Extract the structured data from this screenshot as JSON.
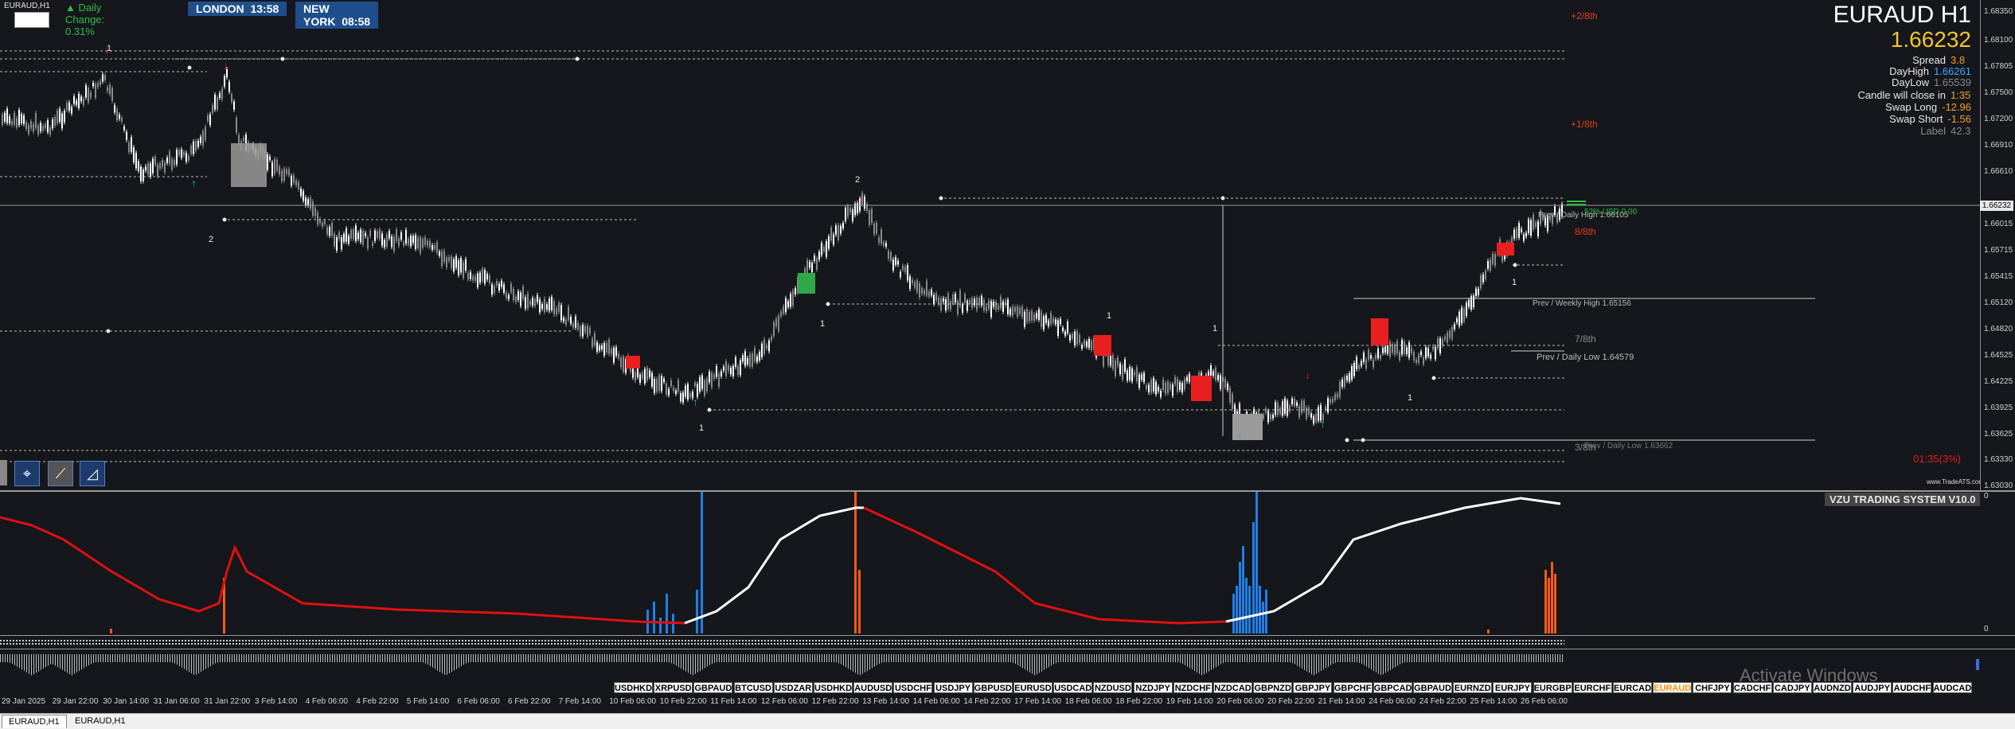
{
  "toolbar": {
    "symbol_label": "EURAUD,H1",
    "daily_change": "▲ Daily Change: 0.31%",
    "london_label": "LONDON",
    "london_time": "13:58",
    "newyork_label": "NEW YORK",
    "newyork_time": "08:58"
  },
  "info": {
    "title": "EURAUD H1",
    "price": "1.66232",
    "rows": [
      {
        "k": "Spread",
        "v": "3.8"
      },
      {
        "k": "DayHigh",
        "v": "1.66261"
      },
      {
        "k": "DayLow",
        "v": "1.65539"
      },
      {
        "k": "Candle will close in",
        "v": "1:35"
      },
      {
        "k": "Swap Long",
        "v": "-12.96"
      },
      {
        "k": "Swap Short",
        "v": "-1.56"
      },
      {
        "k": "Label",
        "v": "42.3"
      }
    ]
  },
  "price_scale": [
    "1.68350",
    "1.68100",
    "1.67805",
    "1.67500",
    "1.67200",
    "1.66910",
    "1.66610",
    "1.66232",
    "1.66015",
    "1.65715",
    "1.65415",
    "1.65120",
    "1.64820",
    "1.64525",
    "1.64225",
    "1.63925",
    "1.63625",
    "1.63330",
    "1.63030"
  ],
  "current_price_tag": "1.66232",
  "levels": {
    "plus2": "+2/8th",
    "plus1": "+1/8th",
    "eighth8": "8/8th",
    "eighth7": "7/8th",
    "eighth3": "3/8th",
    "prev_daily_high": "Prev / Daily High 1.66105",
    "prev_weekly_high": "Prev / Weekly High 1.65156",
    "prev_daily_low": "Prev / Daily Low 1.64579",
    "target_label": "52% USD 0.00",
    "prev_low_2": "Prev / Daily Low 1.63662",
    "countdown": "01:35(3%)",
    "site": "www.TradeATS.com"
  },
  "swing_labels": [
    "2",
    "2",
    "1",
    "1",
    "1",
    "1",
    "1",
    "1",
    "1"
  ],
  "indicator": {
    "title": "VZU TRADING SYSTEM V10.0",
    "scale_top": "0",
    "scale_bottom": "0",
    "colors": {
      "bull": "#ffffff",
      "bear": "#e01010",
      "blue_bar": "#1f7fe8",
      "orange_bar": "#ff5a10"
    }
  },
  "time_axis": [
    "29 Jan 2025",
    "29 Jan 22:00",
    "30 Jan 14:00",
    "31 Jan 06:00",
    "31 Jan 22:00",
    "3 Feb 14:00",
    "4 Feb 06:00",
    "4 Feb 22:00",
    "5 Feb 14:00",
    "6 Feb 06:00",
    "6 Feb 22:00",
    "7 Feb 14:00",
    "10 Feb 06:00",
    "10 Feb 22:00",
    "11 Feb 14:00",
    "12 Feb 06:00",
    "12 Feb 22:00",
    "13 Feb 14:00",
    "14 Feb 06:00",
    "14 Feb 22:00",
    "17 Feb 14:00",
    "18 Feb 06:00",
    "18 Feb 22:00",
    "19 Feb 14:00",
    "20 Feb 06:00",
    "20 Feb 22:00",
    "21 Feb 14:00",
    "24 Feb 06:00",
    "24 Feb 22:00",
    "25 Feb 14:00",
    "26 Feb 06:00"
  ],
  "symbols": [
    "USDHKD",
    "XRPUSD",
    "GBPAUD",
    "BTCUSD",
    "USDZAR",
    "USDHKD",
    "AUDUSD",
    "USDCHF",
    "USDJPY",
    "GBPUSD",
    "EURUSD",
    "USDCAD",
    "NZDUSD",
    "NZDJPY",
    "NZDCHF",
    "NZDCAD",
    "GBPNZD",
    "GBPJPY",
    "GBPCHF",
    "GBPCAD",
    "GBPAUD",
    "EURNZD",
    "EURJPY",
    "EURGBP",
    "EURCHF",
    "EURCAD",
    "EURAUD",
    "CHFJPY",
    "CADCHF",
    "CADJPY",
    "AUDNZD",
    "AUDJPY",
    "AUDCHF",
    "AUDCAD"
  ],
  "active_symbol": "EURAUD",
  "watermark": "Activate Windows",
  "tabs": [
    "EURAUD,H1",
    "EURAUD,H1"
  ]
}
